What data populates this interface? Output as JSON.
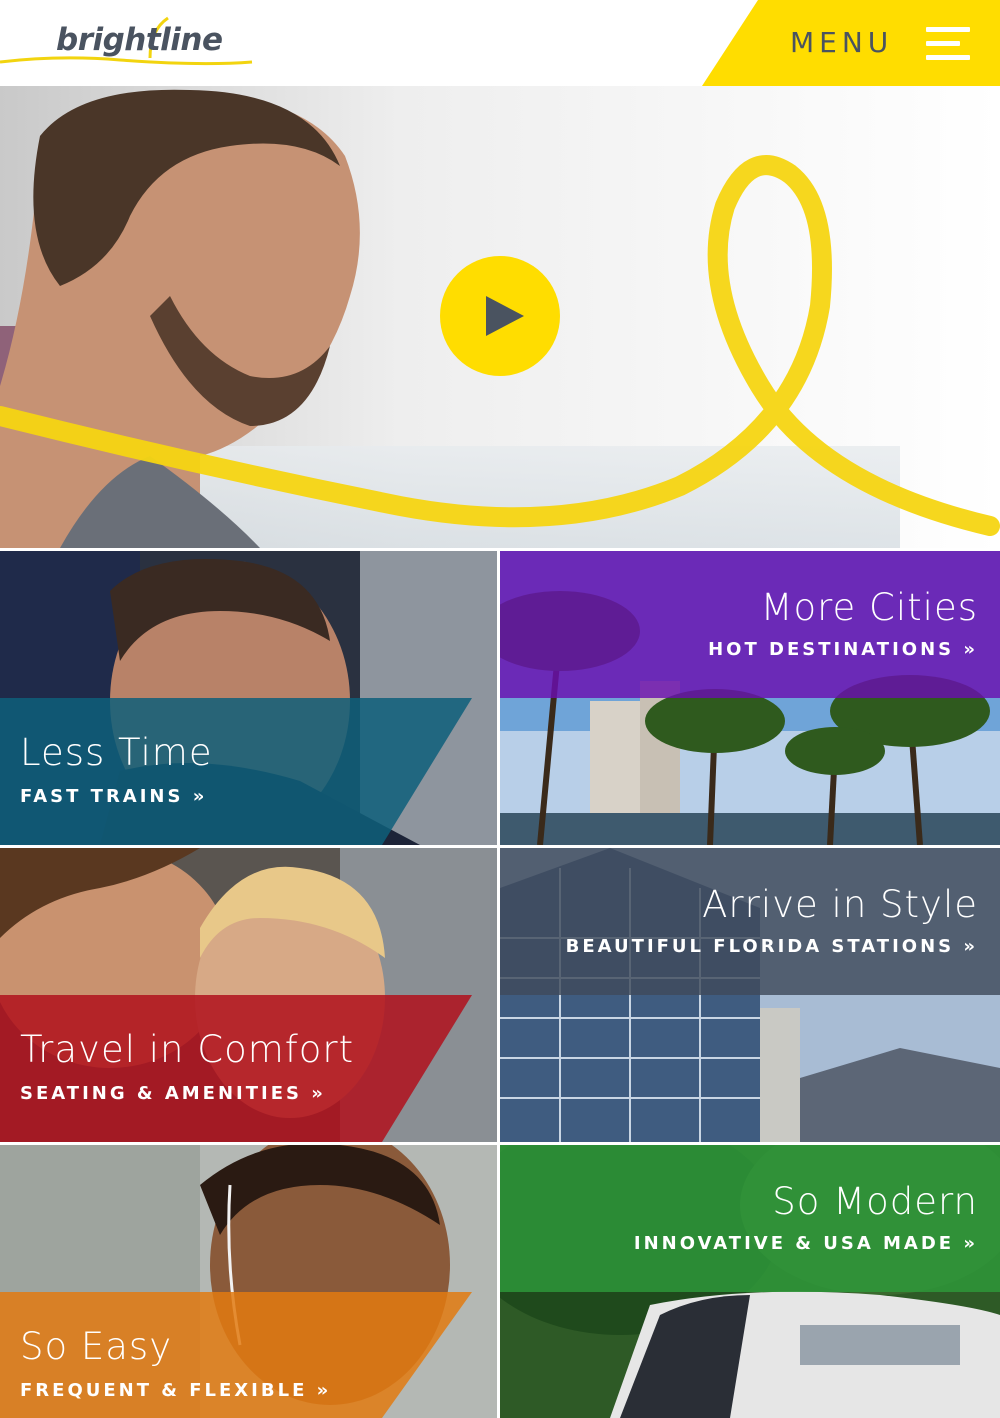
{
  "brand": {
    "logo_text": "brightline",
    "accent": "#ffdd00",
    "text_color": "#4a5360"
  },
  "header": {
    "menu_label": "MENU",
    "menu_icon": "hamburger-icon"
  },
  "hero": {
    "play_icon": "play-icon"
  },
  "tiles": [
    {
      "title": "Less Time",
      "subtitle": "FAST TRAINS »",
      "band_color": "#0e5f7a"
    },
    {
      "title": "More Cities",
      "subtitle": "HOT DESTINATIONS »",
      "band_color": "#7a1fa6"
    },
    {
      "title": "Travel in Comfort",
      "subtitle": "SEATING & AMENITIES »",
      "band_color": "#b0101c"
    },
    {
      "title": "Arrive in Style",
      "subtitle": "BEAUTIFUL FLORIDA STATIONS »",
      "band_color": "#3f4a5c"
    },
    {
      "title": "So Easy",
      "subtitle": "FREQUENT & FLEXIBLE »",
      "band_color": "#e27a10"
    },
    {
      "title": "So Modern",
      "subtitle": "INNOVATIVE & USA MADE »",
      "band_color": "#2e9a3a"
    }
  ]
}
